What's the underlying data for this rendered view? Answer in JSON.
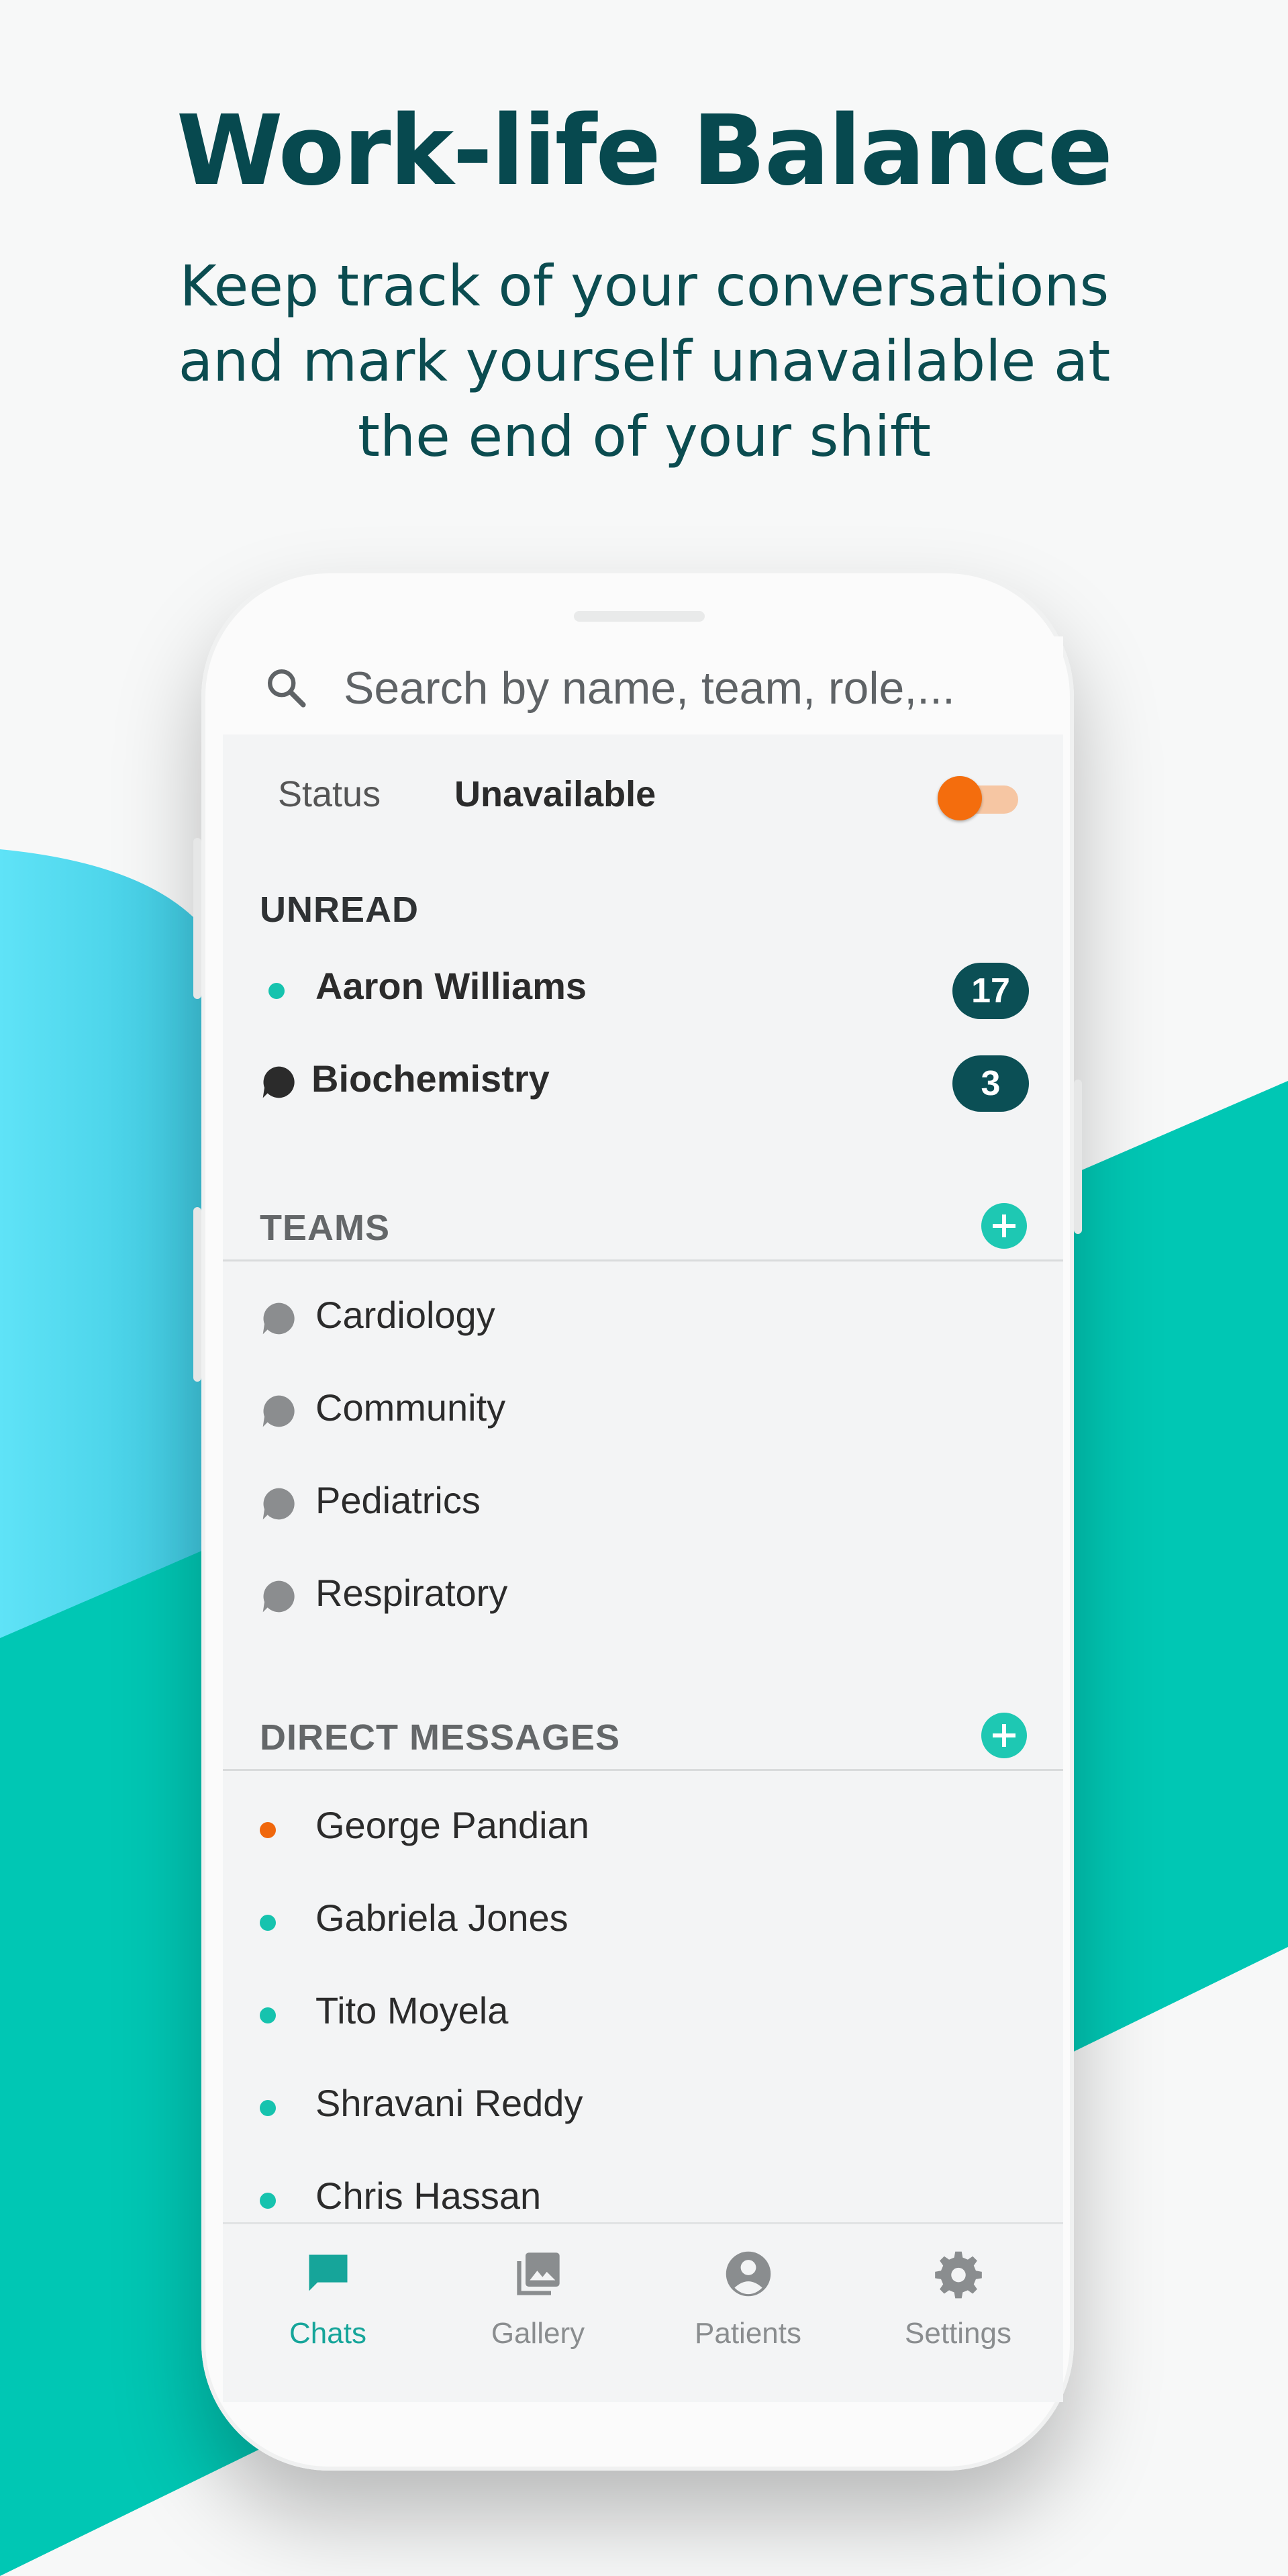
{
  "hero": {
    "title": "Work-life Balance",
    "subtitle": "Keep track of your conversations and mark yourself unavailable at the end of your shift"
  },
  "colors": {
    "brand_dark": "#07494f",
    "teal": "#00c7b4",
    "light_blue": "#5fe2f5",
    "orange": "#f46d0d",
    "badge": "#0b4f55"
  },
  "search": {
    "placeholder": "Search by name, team, role,..."
  },
  "status": {
    "label": "Status",
    "value": "Unavailable",
    "toggle_on": true
  },
  "unread": {
    "header": "UNREAD",
    "items": [
      {
        "name": "Aaron Williams",
        "count": "17",
        "icon": "dot-available"
      },
      {
        "name": "Biochemistry",
        "count": "3",
        "icon": "chat-bubble-icon"
      }
    ]
  },
  "teams": {
    "header": "TEAMS",
    "items": [
      {
        "name": "Cardiology"
      },
      {
        "name": "Community"
      },
      {
        "name": "Pediatrics"
      },
      {
        "name": "Respiratory"
      }
    ]
  },
  "direct_messages": {
    "header": "DIRECT MESSAGES",
    "items": [
      {
        "name": "George Pandian",
        "status": "unavailable"
      },
      {
        "name": "Gabriela Jones",
        "status": "available"
      },
      {
        "name": "Tito Moyela",
        "status": "available"
      },
      {
        "name": "Shravani Reddy",
        "status": "available"
      },
      {
        "name": "Chris Hassan",
        "status": "available"
      }
    ]
  },
  "nav": {
    "items": [
      {
        "label": "Chats",
        "icon": "chat-icon",
        "active": true
      },
      {
        "label": "Gallery",
        "icon": "gallery-icon",
        "active": false
      },
      {
        "label": "Patients",
        "icon": "account-circle-icon",
        "active": false
      },
      {
        "label": "Settings",
        "icon": "gear-icon",
        "active": false
      }
    ]
  }
}
